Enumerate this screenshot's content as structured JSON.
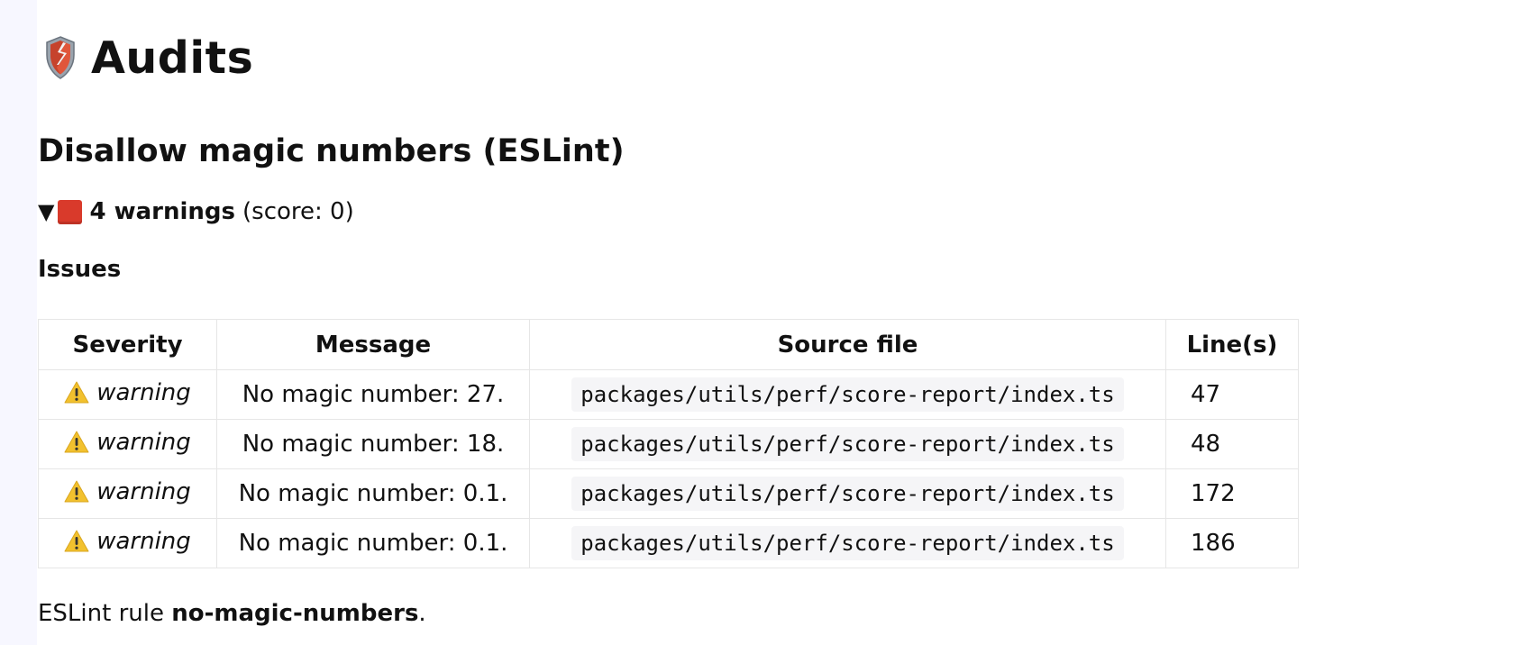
{
  "header": {
    "icon": "shield-icon",
    "title": "Audits"
  },
  "audit": {
    "title": "Disallow magic numbers (ESLint)",
    "summary_icon": "red-square-icon",
    "summary_count": "4 warnings",
    "summary_score": "(score: 0)",
    "issues_heading": "Issues"
  },
  "table": {
    "headers": [
      "Severity",
      "Message",
      "Source file",
      "Line(s)"
    ],
    "rows": [
      {
        "severity": "warning",
        "message": "No magic number: 27.",
        "file": "packages/utils/perf/score-report/index.ts",
        "line": "47"
      },
      {
        "severity": "warning",
        "message": "No magic number: 18.",
        "file": "packages/utils/perf/score-report/index.ts",
        "line": "48"
      },
      {
        "severity": "warning",
        "message": "No magic number: 0.1.",
        "file": "packages/utils/perf/score-report/index.ts",
        "line": "172"
      },
      {
        "severity": "warning",
        "message": "No magic number: 0.1.",
        "file": "packages/utils/perf/score-report/index.ts",
        "line": "186"
      }
    ]
  },
  "footer": {
    "prefix": "ESLint rule ",
    "rule": "no-magic-numbers",
    "suffix": "."
  },
  "colors": {
    "warning": "#f2c12e",
    "score_red": "#d93a2b",
    "sidebar": "#f7f7ff"
  }
}
